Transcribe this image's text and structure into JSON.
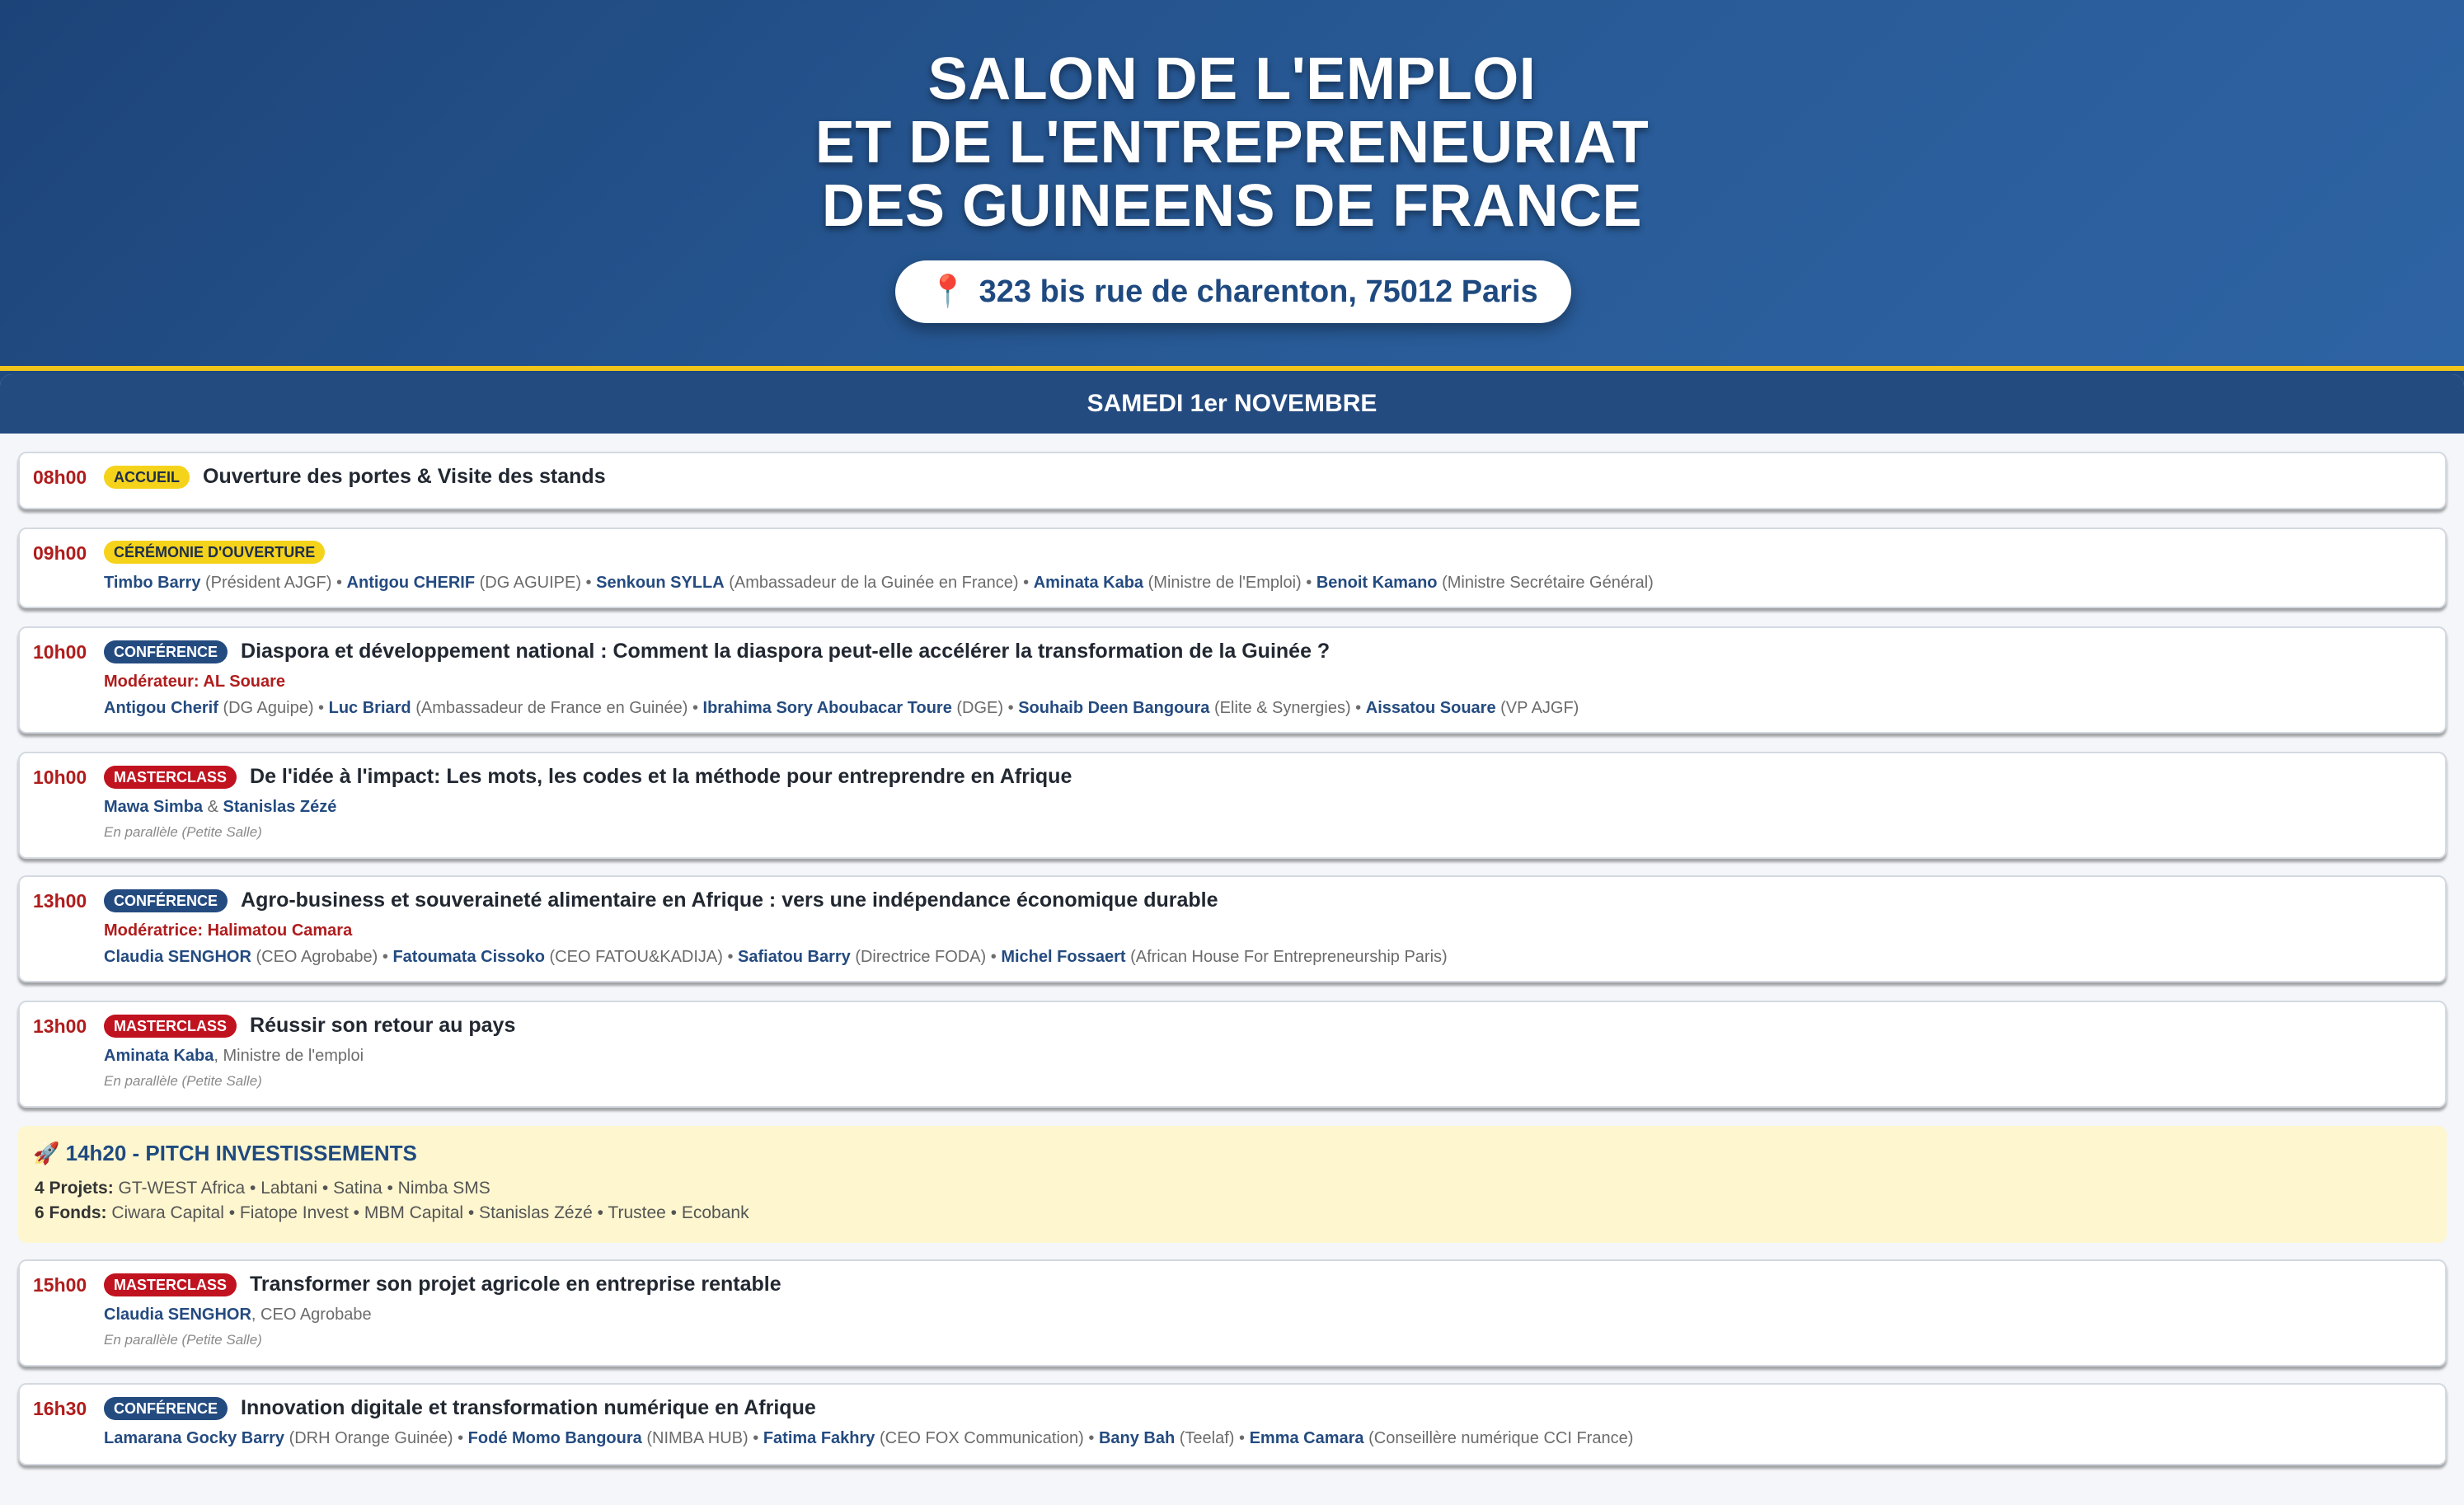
{
  "header": {
    "title_lines": [
      "SALON DE L'EMPLOI",
      "ET DE L'ENTREPRENEURIAT",
      "DES GUINEENS DE FRANCE"
    ],
    "address": "323 bis rue de charenton, 75012 Paris",
    "address_icon": "📍"
  },
  "day": "SAMEDI 1er NOVEMBRE",
  "colors": {
    "primary": "#244b80",
    "accent_yellow": "#f5d31b",
    "accent_red": "#c1121f",
    "time_red": "#b01c1c",
    "pitch_bg": "#fdf6cf"
  },
  "events": [
    {
      "time": "08h00",
      "badge": "ACCUEIL",
      "badge_color": "yellow",
      "title": "Ouverture des portes & Visite des stands"
    },
    {
      "time": "09h00",
      "badge": "CÉRÉMONIE D'OUVERTURE",
      "badge_color": "yellow",
      "speakers": [
        {
          "name": "Timbo Barry",
          "role": "(Président AJGF)"
        },
        {
          "name": "Antigou CHERIF",
          "role": "(DG AGUIPE)"
        },
        {
          "name": "Senkoun SYLLA",
          "role": "(Ambassadeur de la Guinée en France)"
        },
        {
          "name": "Aminata Kaba",
          "role": "(Ministre de l'Emploi)"
        },
        {
          "name": "Benoit Kamano",
          "role": "(Ministre Secrétaire Général)"
        }
      ]
    },
    {
      "time": "10h00",
      "badge": "CONFÉRENCE",
      "badge_color": "blue",
      "title": "Diaspora et développement national : Comment la diaspora peut-elle accélérer la transformation de la Guinée ?",
      "moderator": "Modérateur: AL Souare",
      "speakers": [
        {
          "name": "Antigou Cherif",
          "role": "(DG Aguipe)"
        },
        {
          "name": "Luc Briard",
          "role": "(Ambassadeur de France en Guinée)"
        },
        {
          "name": "Ibrahima Sory Aboubacar Toure",
          "role": "(DGE)"
        },
        {
          "name": "Souhaib Deen Bangoura",
          "role": "(Elite & Synergies)"
        },
        {
          "name": "Aissatou Souare",
          "role": "(VP AJGF)"
        }
      ]
    },
    {
      "time": "10h00",
      "badge": "MASTERCLASS",
      "badge_color": "red",
      "title": "De l'idée à l'impact: Les mots, les codes et la méthode pour entreprendre en Afrique",
      "speaker_a": "Mawa Simba",
      "joiner": "&",
      "speaker_b": "Stanislas Zézé",
      "note": "En parallèle (Petite Salle)"
    },
    {
      "time": "13h00",
      "badge": "CONFÉRENCE",
      "badge_color": "blue",
      "title": "Agro-business et souveraineté alimentaire en Afrique : vers une indépendance économique durable",
      "moderator": "Modératrice: Halimatou Camara",
      "speakers": [
        {
          "name": "Claudia SENGHOR",
          "role": "(CEO Agrobabe)"
        },
        {
          "name": "Fatoumata Cissoko",
          "role": "(CEO FATOU&KADIJA)"
        },
        {
          "name": "Safiatou Barry",
          "role": "(Directrice FODA)"
        },
        {
          "name": "Michel Fossaert",
          "role": "(African House For Entrepreneurship Paris)"
        }
      ]
    },
    {
      "time": "13h00",
      "badge": "MASTERCLASS",
      "badge_color": "red",
      "title": "Réussir son retour au pays",
      "speaker_a": "Aminata Kaba",
      "speaker_role": ", Ministre de l'emploi",
      "note": "En parallèle (Petite Salle)"
    },
    {
      "time": "15h00",
      "badge": "MASTERCLASS",
      "badge_color": "red",
      "title": "Transformer son projet agricole en entreprise rentable",
      "speaker_a": "Claudia SENGHOR",
      "speaker_role": ", CEO Agrobabe",
      "note": "En parallèle (Petite Salle)"
    },
    {
      "time": "16h30",
      "badge": "CONFÉRENCE",
      "badge_color": "blue",
      "title": "Innovation digitale et transformation numérique en Afrique",
      "speakers": [
        {
          "name": "Lamarana Gocky Barry",
          "role": "(DRH Orange Guinée)"
        },
        {
          "name": "Fodé Momo Bangoura",
          "role": "(NIMBA HUB)"
        },
        {
          "name": "Fatima Fakhry",
          "role": "(CEO FOX Communication)"
        },
        {
          "name": "Bany Bah",
          "role": "(Teelaf)"
        },
        {
          "name": "Emma Camara",
          "role": "(Conseillère numérique CCI France)"
        }
      ]
    }
  ],
  "pitch": {
    "icon": "🚀",
    "title": "14h20 - PITCH INVESTISSEMENTS",
    "projects_label": "4 Projets:",
    "projects": "GT-WEST Africa • Labtani • Satina • Nimba SMS",
    "funds_label": "6 Fonds:",
    "funds": "Ciwara Capital • Fiatope Invest • MBM Capital • Stanislas Zézé • Trustee • Ecobank"
  }
}
